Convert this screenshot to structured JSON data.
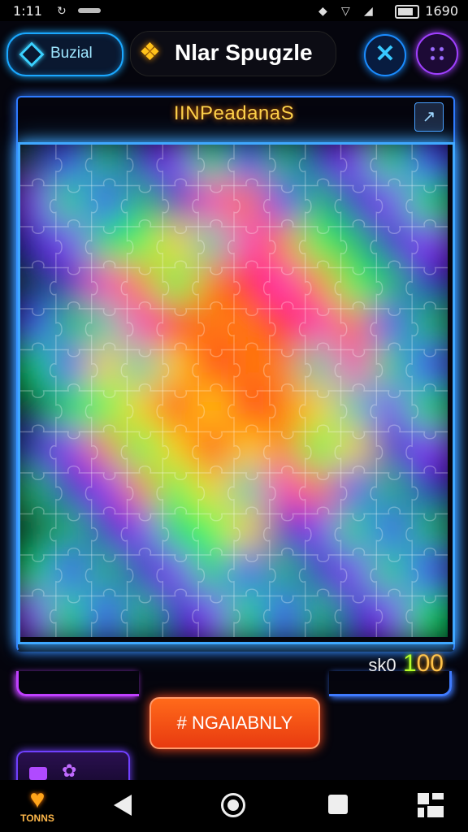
{
  "status_bar": {
    "time": "1:11",
    "clock_right": "1690"
  },
  "header": {
    "tutorial_label": "Buzial",
    "title": "Nlar Spugzle",
    "title_icon": "puzzle-piece-icon",
    "close_icon": "close-icon",
    "menu_icon": "grid-icon"
  },
  "board": {
    "title": "IINPeadanaS",
    "pin_icon": "pin-icon",
    "columns": 12,
    "rows": 12
  },
  "score": {
    "label": "sk0",
    "value_green": "1",
    "value_orange": "00"
  },
  "action_button": {
    "label": "# NGAIABNLY"
  },
  "nav": {
    "tokens_label": "TONNS",
    "tokens_icon": "heart-token-icon"
  },
  "colors": {
    "board_border": "#3fa8ff",
    "title": "#ffd24a",
    "action": "#ff5a1a",
    "palette": [
      "#00e060",
      "#20c060",
      "#0a4a30",
      "#8a2bff",
      "#4a30ff",
      "#2a20c0",
      "#ff2020",
      "#ff7a10",
      "#ffd400",
      "#30ff60",
      "#ff20c0",
      "#10d0b0",
      "#1a8aff",
      "#c030ff",
      "#b0ff20"
    ]
  }
}
